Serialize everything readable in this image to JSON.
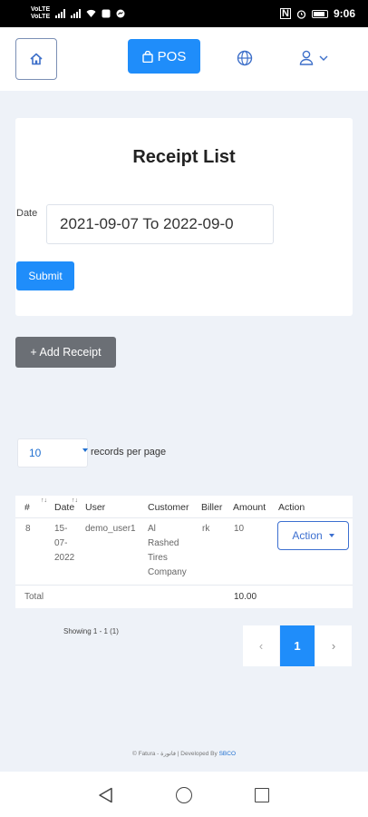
{
  "status_bar": {
    "sim1": "VoLTE",
    "sim2": "VoLTE",
    "indicator_n": "N",
    "time": "9:06"
  },
  "topbar": {
    "pos_label": "POS",
    "home_icon": "home-icon",
    "globe_icon": "globe-icon",
    "user_icon": "user-icon"
  },
  "receipt_card": {
    "title": "Receipt List",
    "date_label": "Date",
    "date_value": "2021-09-07 To 2022-09-0",
    "submit_label": "Submit"
  },
  "add_receipt_label": "+ Add Receipt",
  "records": {
    "selected": "10",
    "label": "records per page"
  },
  "table": {
    "headers": [
      "#",
      "Date",
      "User",
      "Customer",
      "Biller",
      "Amount",
      "Action"
    ],
    "rows": [
      {
        "id": "8",
        "date_lines": [
          "15-",
          "07-",
          "2022"
        ],
        "user": "demo_user1",
        "customer_lines": [
          "Al",
          "Rashed",
          "Tires",
          "Company"
        ],
        "biller": "rk",
        "amount": "10",
        "action_label": "Action"
      }
    ],
    "total_label": "Total",
    "total_amount": "10.00"
  },
  "showing_text": "Showing 1 - 1 (1)",
  "pagination": {
    "prev": "‹",
    "current": "1",
    "next": "›"
  },
  "footer": {
    "text": "© Fatura - فاتورة | Developed By",
    "brand": "SBCO"
  },
  "colors": {
    "primary": "#1f8dfa",
    "secondary": "#6b6f75",
    "background": "#eef2f8"
  }
}
